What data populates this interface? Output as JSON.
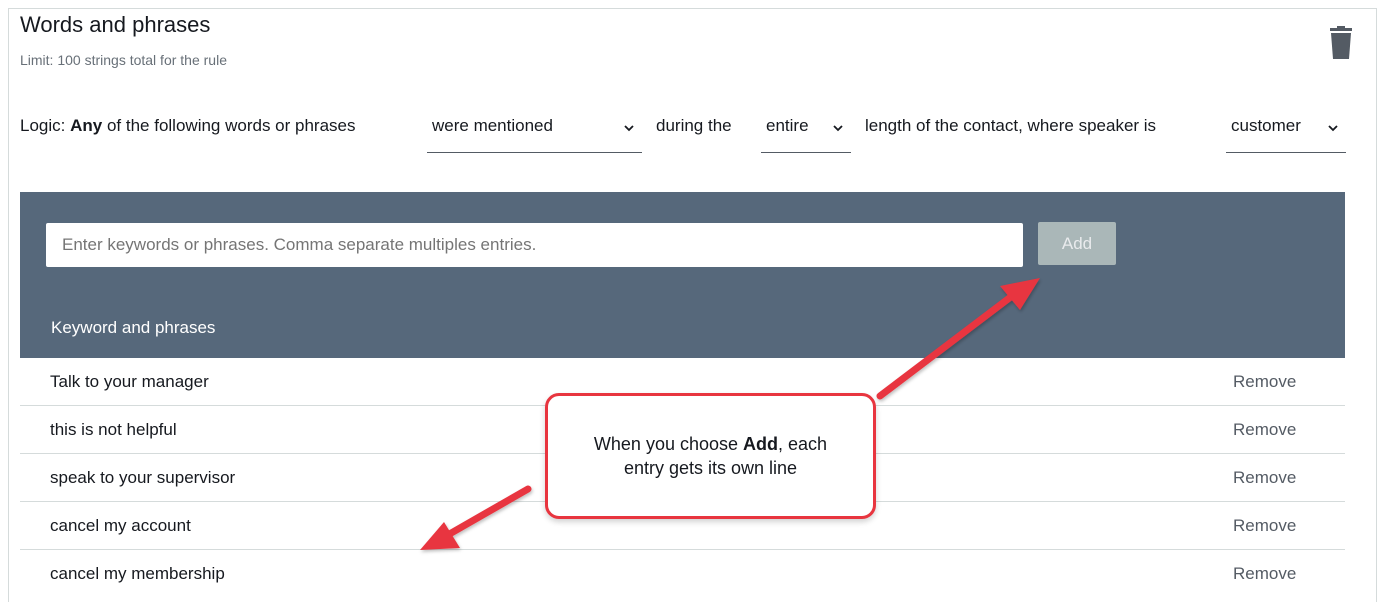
{
  "section": {
    "title": "Words and phrases",
    "limit": "Limit: 100 strings total for the rule"
  },
  "icons": {
    "delete": "trash-icon",
    "dropdown": "chevron-down-icon"
  },
  "logic": {
    "label": "Logic:",
    "any": "Any",
    "of_following": "of the following words or phrases",
    "during": "during the",
    "length": "length of the contact, where speaker is",
    "mention_select": {
      "value": "were mentioned"
    },
    "period_select": {
      "value": "entire"
    },
    "speaker_select": {
      "value": "customer"
    }
  },
  "input": {
    "placeholder": "Enter keywords or phrases. Comma separate multiples entries.",
    "value": ""
  },
  "add_button": {
    "label": "Add",
    "enabled": false
  },
  "table": {
    "header": "Keyword and phrases",
    "rows": [
      {
        "keyword": "Talk to your manager",
        "action": "Remove"
      },
      {
        "keyword": "this is not helpful",
        "action": "Remove"
      },
      {
        "keyword": "speak to your supervisor",
        "action": "Remove"
      },
      {
        "keyword": "cancel my account",
        "action": "Remove"
      },
      {
        "keyword": "cancel my membership",
        "action": "Remove"
      }
    ]
  },
  "callout": {
    "prefix": "When you choose",
    "bold": "Add",
    "suffix": ", each",
    "line2": "entry gets its own line"
  },
  "colors": {
    "panel": "#56687b",
    "add_disabled": "#aab7b8",
    "callout_border": "#e8353f",
    "arrow": "#e8353f"
  }
}
